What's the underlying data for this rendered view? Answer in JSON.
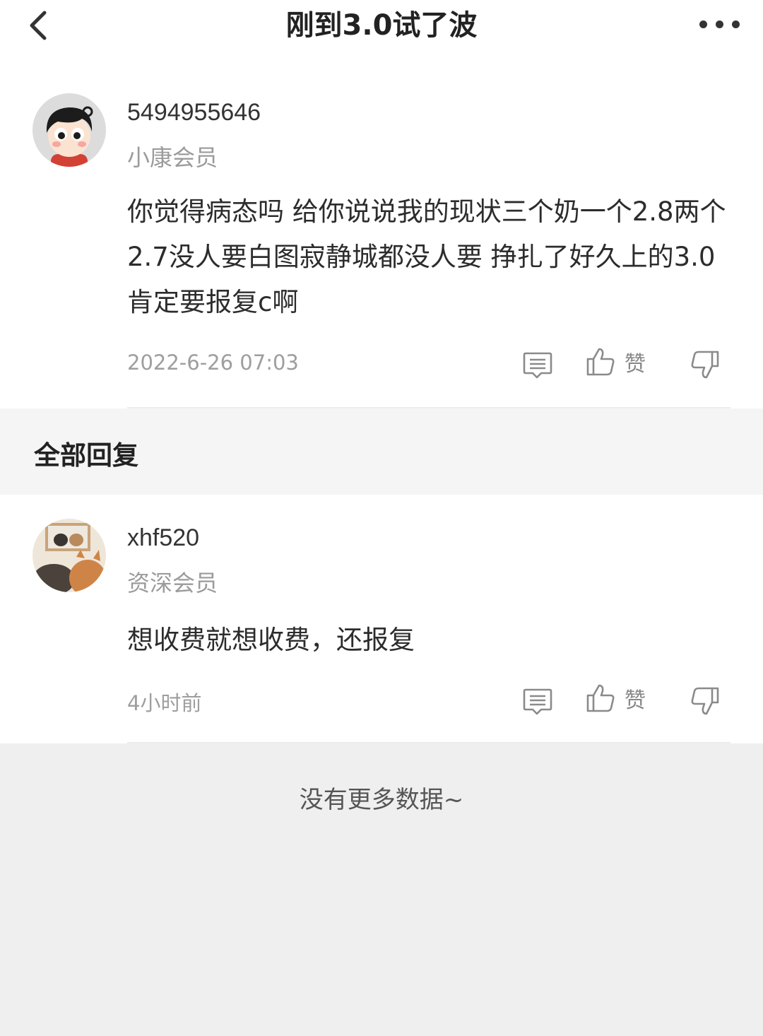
{
  "header": {
    "title": "刚到3.0试了波"
  },
  "post": {
    "username": "5494955646",
    "level": "小康会员",
    "content": "你觉得病态吗  给你说说我的现状三个奶一个2.8两个2.7没人要白图寂静城都没人要  挣扎了好久上的3.0肯定要报复c啊",
    "time": "2022-6-26 07:03",
    "like_label": "赞"
  },
  "section": {
    "title": "全部回复"
  },
  "replies": [
    {
      "username": "xhf520",
      "level": "资深会员",
      "content": "想收费就想收费，还报复",
      "time": "4小时前",
      "like_label": "赞"
    }
  ],
  "footer": {
    "no_more": "没有更多数据~"
  }
}
